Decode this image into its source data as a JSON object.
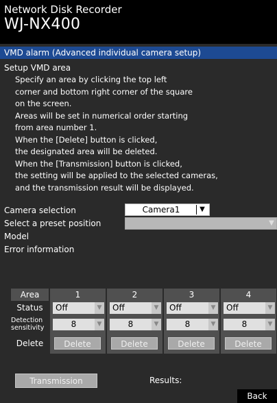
{
  "header": {
    "app_name": "Network Disk Recorder",
    "model": "WJ-NX400"
  },
  "section": {
    "title": "VMD alarm (Advanced individual camera setup)",
    "subhead": "Setup VMD area"
  },
  "instructions": [
    "Specify an area by clicking the top left",
    "corner and bottom right corner of the square",
    "on the screen.",
    "Areas will be set in numerical order starting",
    "from area number 1.",
    "When the [Delete] button is clicked,",
    "the designated area will be deleted.",
    "When the [Transmission]  button is clicked,",
    "the setting will be applied to the selected cameras,",
    "and the transmission result will be displayed."
  ],
  "form": {
    "camera_selection_label": "Camera selection",
    "camera_selection_value": "Camera1",
    "preset_label": "Select a preset position",
    "preset_value": "",
    "model_label": "Model",
    "model_value": "",
    "error_label": "Error information",
    "error_value": ""
  },
  "area_table": {
    "area_label": "Area",
    "status_label": "Status",
    "sensitivity_label": "Detection sensitivity",
    "delete_label": "Delete",
    "areas": [
      {
        "number": "1",
        "status": "Off",
        "sensitivity": "8",
        "delete_button": "Delete"
      },
      {
        "number": "2",
        "status": "Off",
        "sensitivity": "8",
        "delete_button": "Delete"
      },
      {
        "number": "3",
        "status": "Off",
        "sensitivity": "8",
        "delete_button": "Delete"
      },
      {
        "number": "4",
        "status": "Off",
        "sensitivity": "8",
        "delete_button": "Delete"
      }
    ]
  },
  "transmission": {
    "button_label": "Transmission",
    "results_label": "Results:",
    "results_value": ""
  },
  "footer": {
    "back_label": "Back"
  },
  "colors": {
    "section_bar": "#1d4a93",
    "panel": "#2a2a2a",
    "cell": "#505050",
    "disabled_button": "#a9a9a9"
  }
}
